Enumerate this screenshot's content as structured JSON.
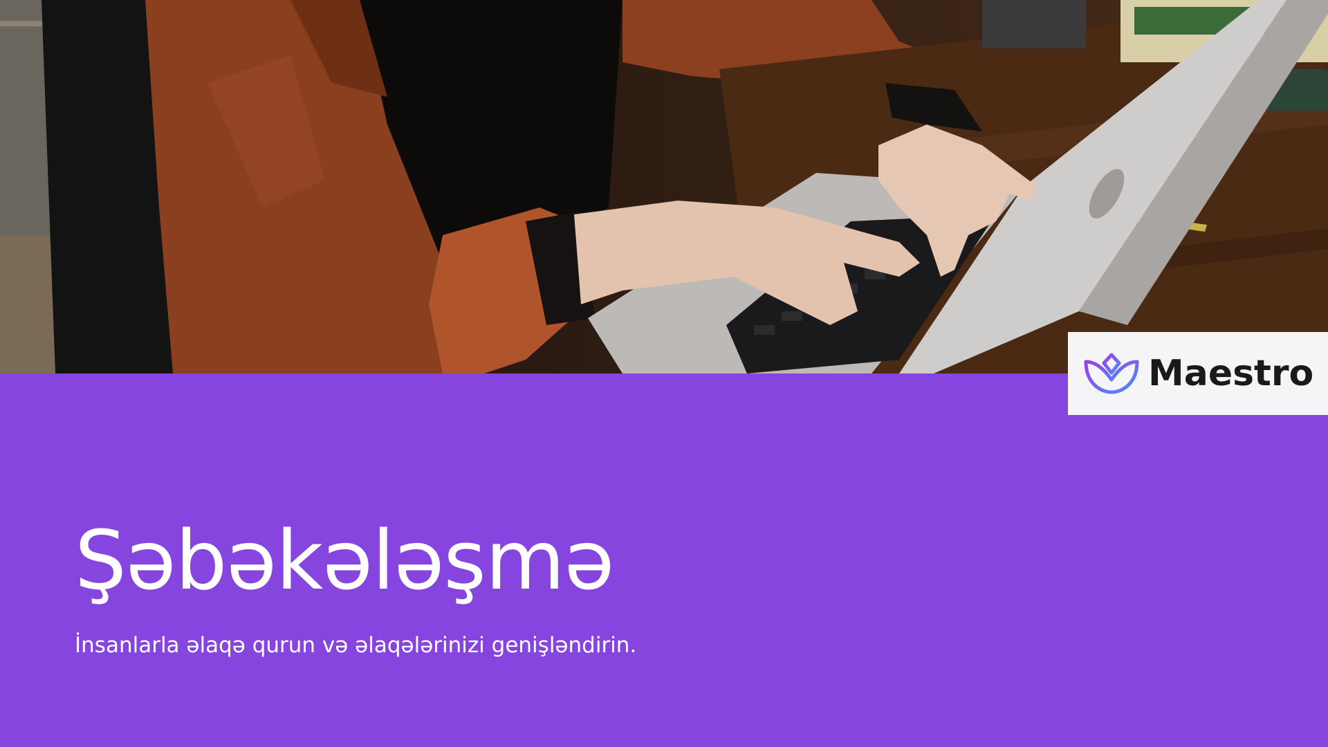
{
  "slide": {
    "title": "Şəbəkələşmə",
    "subtitle": "İnsanlarla əlaqə qurun və əlaqələrinizi genişləndirin."
  },
  "logo": {
    "text": "Maestro",
    "icon": "lotus-icon"
  },
  "hero": {
    "image": "photo-person-typing-on-laptop"
  },
  "colors": {
    "background": "#8745e0",
    "text": "#ffffff",
    "logo_background": "#f5f4f6",
    "logo_text": "#1a1a1a",
    "logo_gradient_start": "#9b3fe6",
    "logo_gradient_end": "#4a8ef5"
  }
}
